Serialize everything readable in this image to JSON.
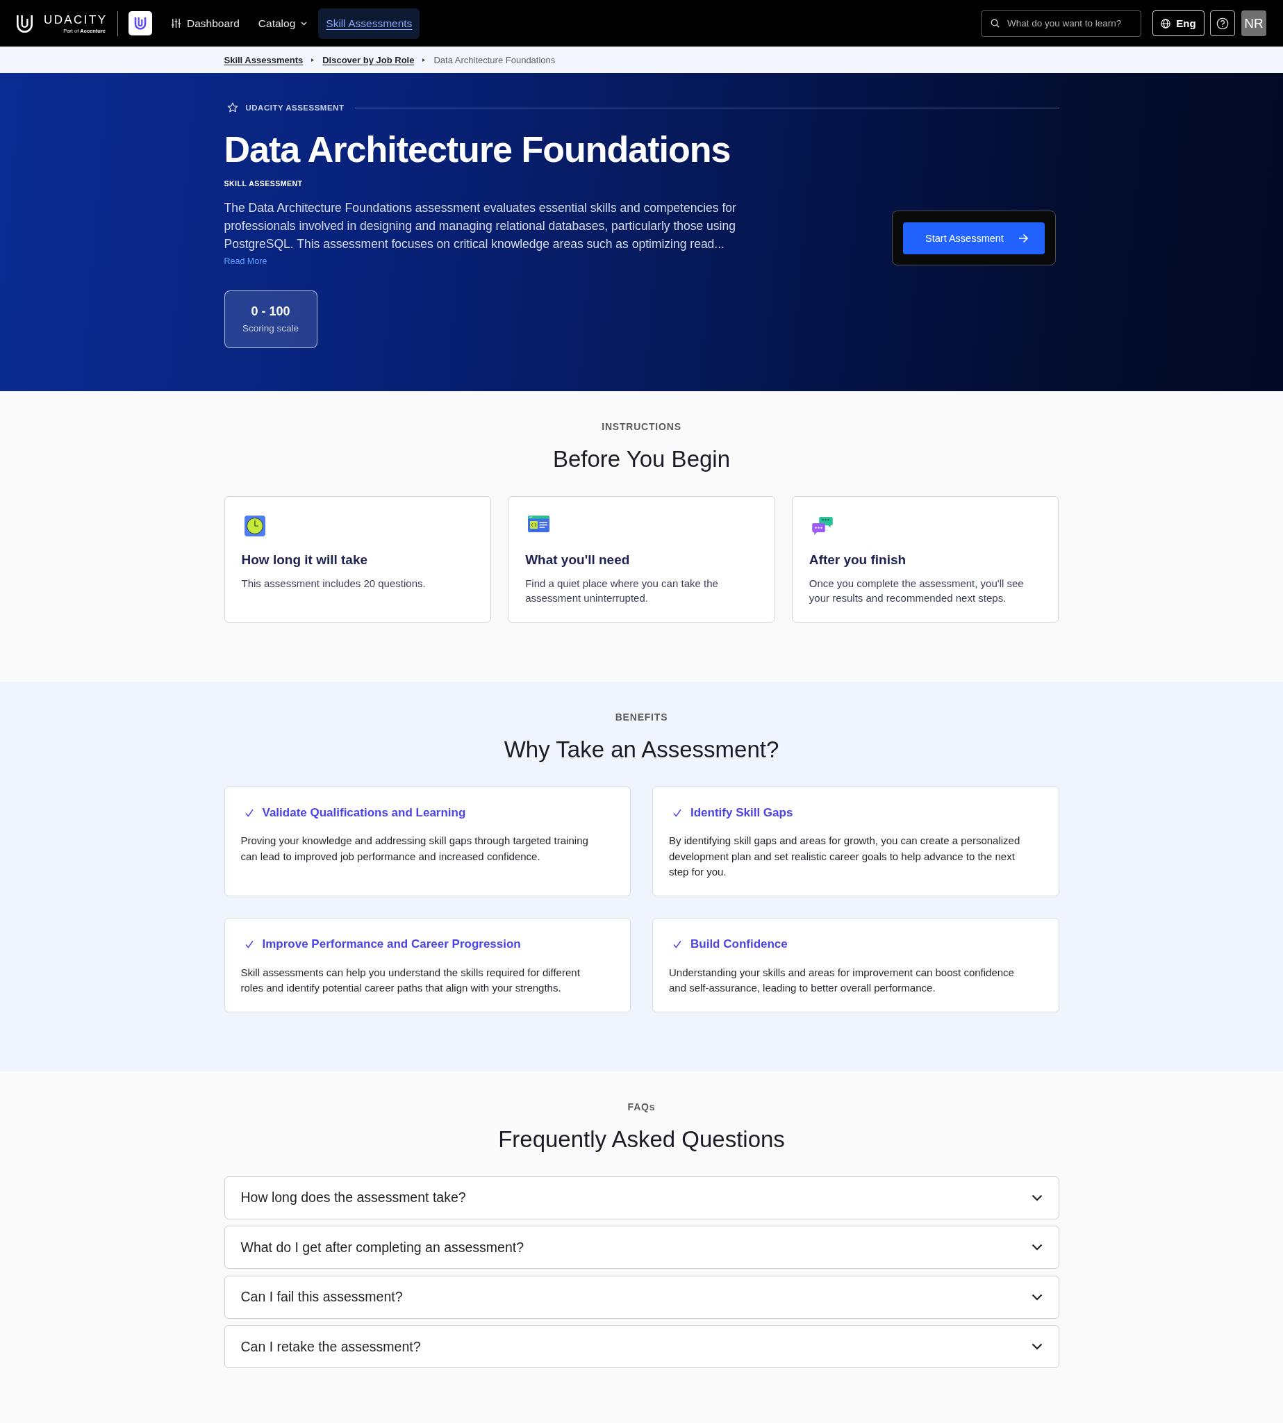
{
  "header": {
    "logo": {
      "wordmark": "UDACITY",
      "tagline": "Part of **Accenture**"
    },
    "nav": [
      {
        "label": "Dashboard",
        "kind": "icon",
        "selected": false
      },
      {
        "label": "Catalog",
        "kind": "menu",
        "selected": false
      },
      {
        "label": "Skill Assessments",
        "kind": "plain",
        "selected": true
      }
    ],
    "search": {
      "placeholder": "What do you want to learn?"
    },
    "language": "Eng",
    "avatar": "NR"
  },
  "breadcrumb": [
    {
      "label": "Skill Assessments",
      "current": false
    },
    {
      "label": "Discover by Job Role",
      "current": false
    },
    {
      "label": "Data Architecture Foundations",
      "current": true
    }
  ],
  "hero": {
    "eyebrow": "UDACITY ASSESSMENT",
    "title": "Data Architecture Foundations",
    "subtitle": "SKILL ASSESSMENT",
    "description": "The Data Architecture Foundations assessment evaluates essential skills and competencies for professionals involved in designing and managing relational databases, particularly those using PostgreSQL. This assessment focuses on critical knowledge areas such as optimizing read...",
    "read_more": "Read More",
    "score": {
      "value": "0 - 100",
      "label": "Scoring scale"
    },
    "cta": "Start Assessment"
  },
  "instructions": {
    "eyebrow": "INSTRUCTIONS",
    "heading": "Before You Begin",
    "cards": [
      {
        "title": "How long it will take",
        "text": "This assessment includes 20 questions."
      },
      {
        "title": "What you'll need",
        "text": "Find a quiet place where you can take the assessment uninterrupted."
      },
      {
        "title": "After you finish",
        "text": "Once you complete the assessment, you'll see your results and recommended next steps."
      }
    ]
  },
  "benefits": {
    "eyebrow": "BENEFITS",
    "heading": "Why Take an Assessment?",
    "cards": [
      {
        "title": "Validate Qualifications and Learning",
        "text": "Proving your knowledge and addressing skill gaps through targeted training can lead to improved job performance and increased confidence."
      },
      {
        "title": "Identify Skill Gaps",
        "text": "By identifying skill gaps and areas for growth, you can create a personalized development plan and set realistic career goals to help advance to the next step for you."
      },
      {
        "title": "Improve Performance and Career Progression",
        "text": "Skill assessments can help you understand the skills required for different roles and identify potential career paths that align with your strengths."
      },
      {
        "title": "Build Confidence",
        "text": "Understanding your skills and areas for improvement can boost confidence and self-assurance, leading to better overall performance."
      }
    ]
  },
  "faqs": {
    "eyebrow": "FAQs",
    "heading": "Frequently Asked Questions",
    "items": [
      {
        "question": "How long does the assessment take?",
        "expanded": false
      },
      {
        "question": "What do I get after completing an assessment?",
        "expanded": false
      },
      {
        "question": "Can I fail this assessment?",
        "expanded": false
      },
      {
        "question": "Can I retake the assessment?",
        "expanded": false
      }
    ]
  }
}
